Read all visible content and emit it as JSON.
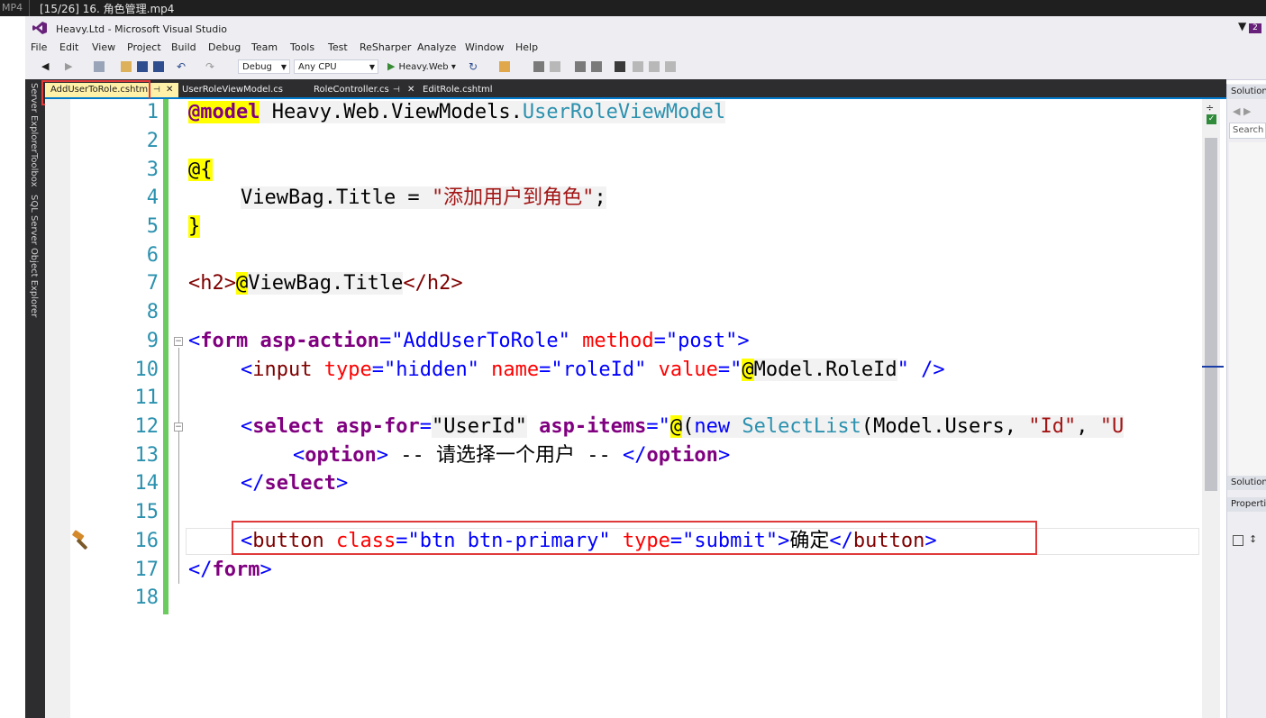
{
  "media": {
    "format": "MP4",
    "title": "[15/26] 16. 角色管理.mp4"
  },
  "window": {
    "title": "Heavy.Ltd - Microsoft Visual Studio",
    "notification_count": "2"
  },
  "menu": [
    "File",
    "Edit",
    "View",
    "Project",
    "Build",
    "Debug",
    "Team",
    "Tools",
    "Test",
    "ReSharper",
    "Analyze",
    "Window",
    "Help"
  ],
  "toolbar": {
    "configuration": "Debug",
    "platform": "Any CPU",
    "startup_project": "Heavy.Web"
  },
  "side_tabs": [
    "Server Explorer",
    "Toolbox",
    "SQL Server Object Explorer"
  ],
  "tabs": [
    {
      "label": "AddUserToRole.cshtml",
      "active": true
    },
    {
      "label": "UserRoleViewModel.cs",
      "active": false
    },
    {
      "label": "RoleController.cs",
      "active": false
    },
    {
      "label": "EditRole.cshtml",
      "active": false
    }
  ],
  "line_numbers": [
    "1",
    "2",
    "3",
    "4",
    "5",
    "6",
    "7",
    "8",
    "9",
    "10",
    "11",
    "12",
    "13",
    "14",
    "15",
    "16",
    "17",
    "18"
  ],
  "code": {
    "l1": {
      "directive": "@model",
      "ns": " Heavy.Web.ViewModels.",
      "type": "UserRoleViewModel"
    },
    "l3": {
      "at": "@",
      "brace": "{"
    },
    "l4": {
      "lhs": "ViewBag.Title",
      "eq": " = ",
      "str": "\"添加用户到角色\"",
      "semi": ";"
    },
    "l5": {
      "brace": "}"
    },
    "l7": {
      "open": "<h2>",
      "at": "@",
      "expr": "ViewBag.Title",
      "close": "</h2>"
    },
    "l9": {
      "lt": "<",
      "tag": "form",
      "a1": " asp-action",
      "eq1": "=",
      "v1": "\"AddUserToRole\"",
      "a2": " method",
      "eq2": "=",
      "v2": "\"post\"",
      "gt": ">"
    },
    "l10": {
      "lt": "<",
      "tag": "input",
      "a1": " type",
      "eq1": "=",
      "v1": "\"hidden\"",
      "a2": " name",
      "eq2": "=",
      "v2": "\"roleId\"",
      "a3": " value",
      "eq3": "=",
      "q": "\"",
      "at": "@",
      "expr": "Model.RoleId",
      "q2": "\"",
      "end": " />"
    },
    "l12": {
      "lt": "<",
      "tag": "select",
      "a1": " asp-for",
      "eq1": "=",
      "v1": "\"UserId\"",
      "a2": " asp-items",
      "eq2": "=",
      "q": "\"",
      "at": "@",
      "paren": "(",
      "new": "new",
      "sp": " ",
      "type": "SelectList",
      "args": "(Model.Users, ",
      "s1": "\"Id\"",
      "comma": ", ",
      "s2": "\"U"
    },
    "l13": {
      "lt": "<",
      "tag": "option",
      "gt": ">",
      "text": " -- 请选择一个用户 -- ",
      "lt2": "</",
      "tag2": "option",
      "gt2": ">"
    },
    "l14": {
      "lt": "</",
      "tag": "select",
      "gt": ">"
    },
    "l16": {
      "lt": "<",
      "tag": "button",
      "a1": " class",
      "eq1": "=",
      "v1": "\"btn btn-primary\"",
      "a2": " type",
      "eq2": "=",
      "v2": "\"submit\"",
      "gt": ">",
      "text": "确定",
      "lt2": "</",
      "tag2": "button",
      "gt2": ">"
    },
    "l17": {
      "lt": "</",
      "tag": "form",
      "gt": ">"
    }
  },
  "right_panel": {
    "header": "Solution Explorer",
    "search": "Search Solution Explorer",
    "footer": "Solution Explorer",
    "properties": "Properties"
  },
  "colors": {
    "accent": "#007acc",
    "highlight_box": "#e03a3a",
    "change_bar": "#6ccb5f",
    "active_tab": "#fff1a8"
  }
}
